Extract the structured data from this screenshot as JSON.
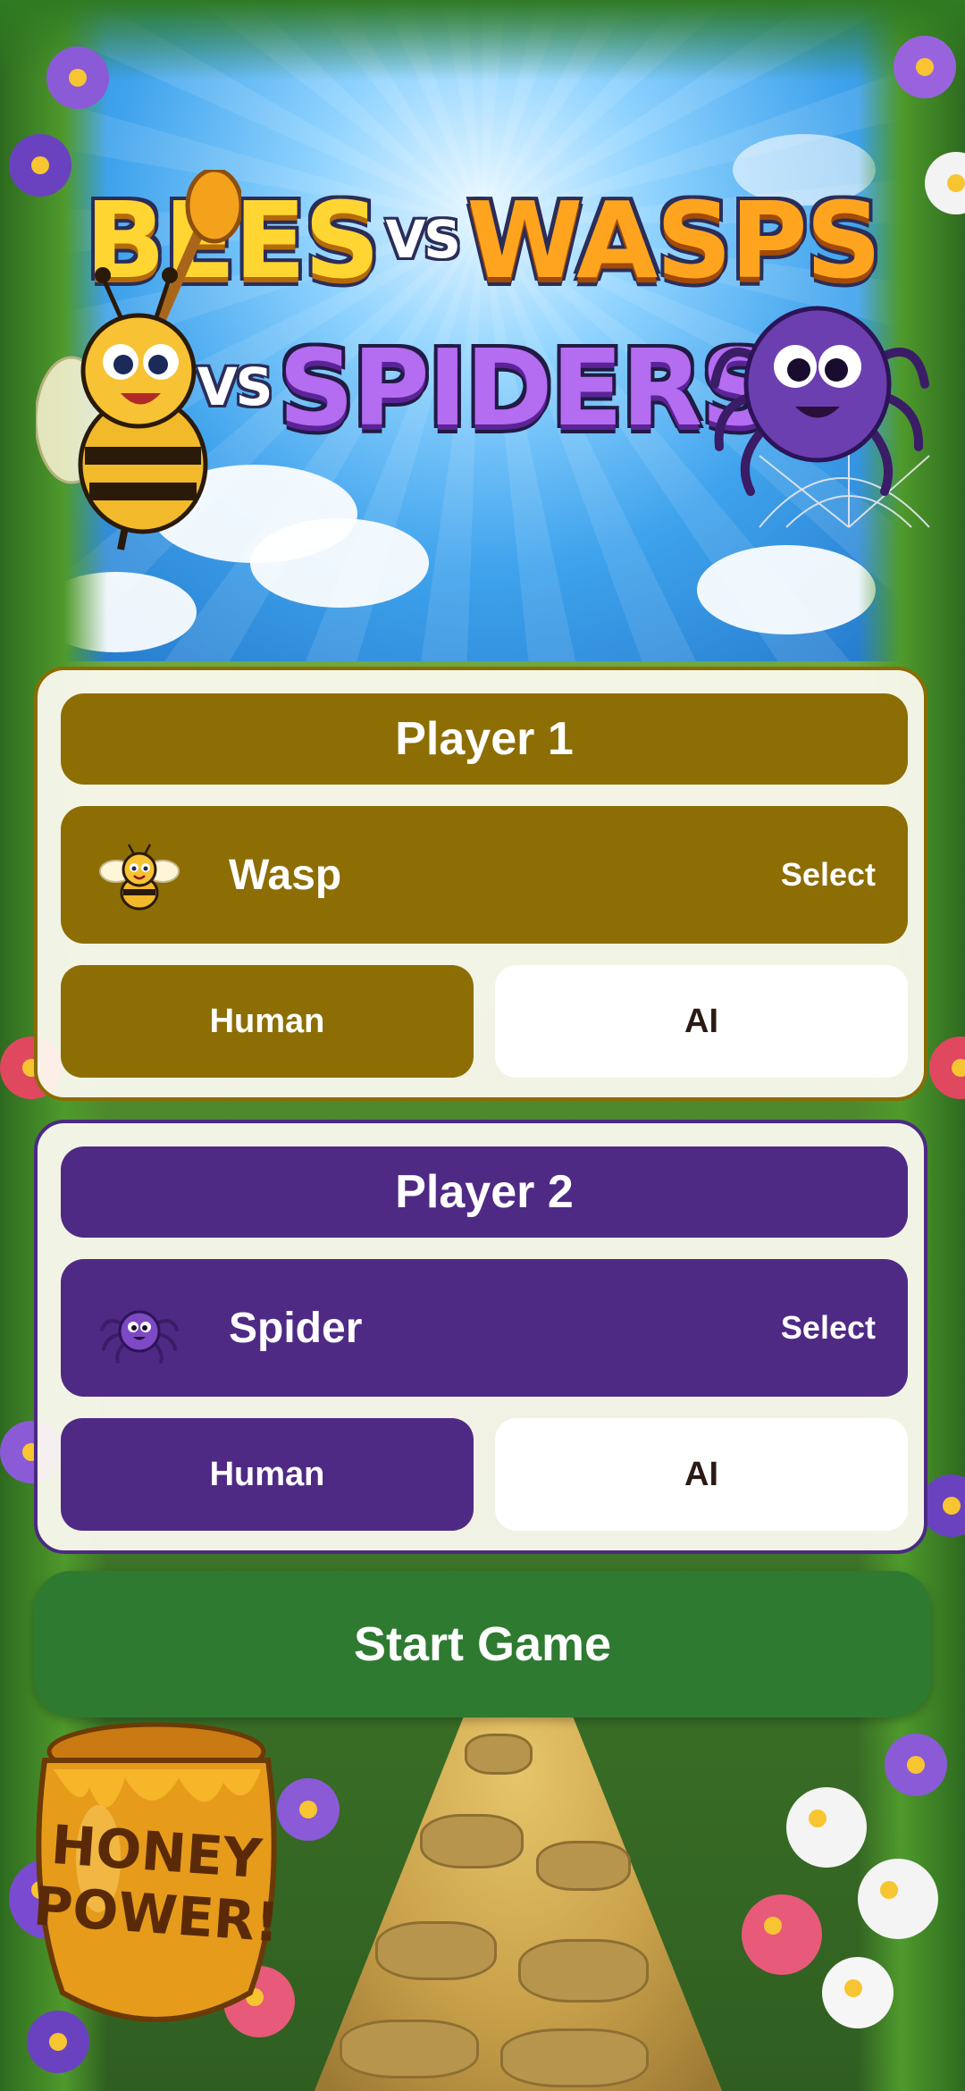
{
  "title": {
    "word1": "BEES",
    "vs1": "VS",
    "word2": "WASPS",
    "vs2": "VS",
    "word3": "SPIDERS"
  },
  "honey_pot": {
    "line1": "HONEY",
    "line2": "POWER!"
  },
  "player1": {
    "header": "Player 1",
    "character_icon": "bee-icon",
    "character_name": "Wasp",
    "select_label": "Select",
    "human_label": "Human",
    "ai_label": "AI",
    "selected_mode": "Human",
    "color": "#8d6e04"
  },
  "player2": {
    "header": "Player 2",
    "character_icon": "spider-icon",
    "character_name": "Spider",
    "select_label": "Select",
    "human_label": "Human",
    "ai_label": "AI",
    "selected_mode": "Human",
    "color": "#4f2a85"
  },
  "start_button": {
    "label": "Start Game",
    "color": "#2e7a31"
  }
}
